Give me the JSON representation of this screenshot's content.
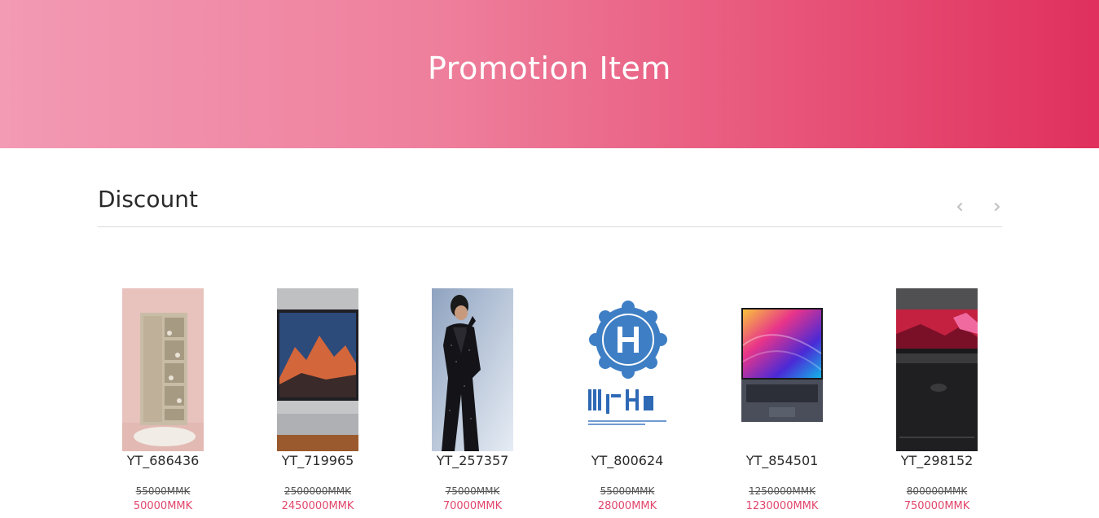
{
  "hero": {
    "title": "Promotion Item"
  },
  "section": {
    "title": "Discount",
    "prev_icon": "chevron-left-icon",
    "next_icon": "chevron-right-icon"
  },
  "colors": {
    "accent": "#e2456b",
    "hero_gradient_start": "#f39ab4",
    "hero_gradient_end": "#e0305d"
  },
  "items": [
    {
      "code": "YT_686436",
      "old_price": "55000MMK",
      "new_price": "50000MMK",
      "image": "wooden-cabinet-photo"
    },
    {
      "code": "YT_719965",
      "old_price": "2500000MMK",
      "new_price": "2450000MMK",
      "image": "macbook-laptop-photo"
    },
    {
      "code": "YT_257357",
      "old_price": "75000MMK",
      "new_price": "70000MMK",
      "image": "man-in-suit-photo"
    },
    {
      "code": "YT_800624",
      "old_price": "55000MMK",
      "new_price": "28000MMK",
      "image": "fluffy-hair-logo"
    },
    {
      "code": "YT_854501",
      "old_price": "1250000MMK",
      "new_price": "1230000MMK",
      "image": "colorful-laptop-photo"
    },
    {
      "code": "YT_298152",
      "old_price": "800000MMK",
      "new_price": "750000MMK",
      "image": "dark-laptop-photo"
    }
  ]
}
